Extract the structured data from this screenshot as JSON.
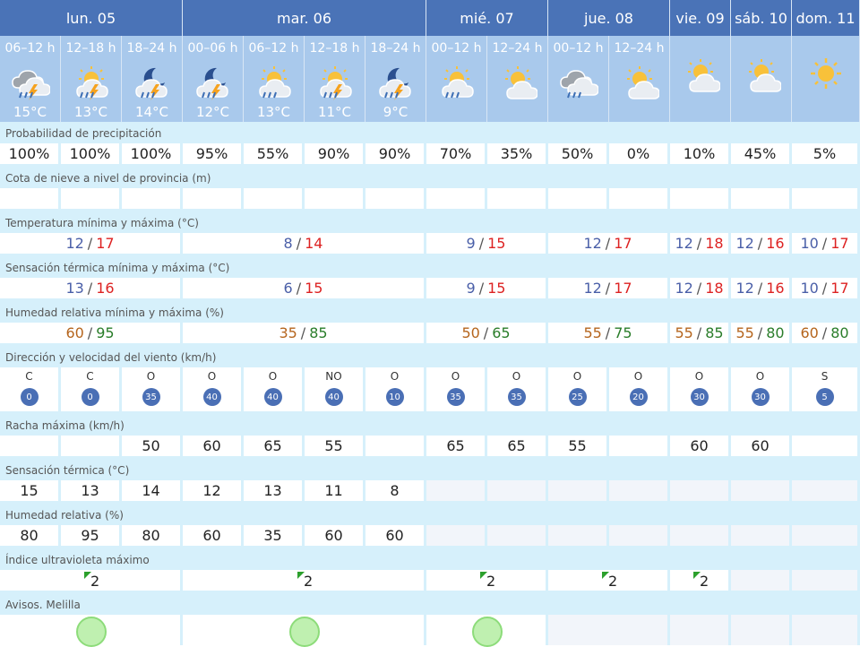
{
  "days": [
    "lun. 05",
    "mar. 06",
    "mié. 07",
    "jue. 08",
    "vie. 09",
    "sáb. 10",
    "dom. 11"
  ],
  "periods": [
    {
      "label": "06–12 h",
      "temp": "15°C",
      "icon": "storm-cloud-icon"
    },
    {
      "label": "12–18 h",
      "temp": "13°C",
      "icon": "sun-storm-rain-icon"
    },
    {
      "label": "18–24 h",
      "temp": "14°C",
      "icon": "night-storm-rain-icon"
    },
    {
      "label": "00–06 h",
      "temp": "12°C",
      "icon": "night-storm-rain-icon"
    },
    {
      "label": "06–12 h",
      "temp": "13°C",
      "icon": "sun-cloud-rain-icon"
    },
    {
      "label": "12–18 h",
      "temp": "11°C",
      "icon": "sun-storm-rain-icon"
    },
    {
      "label": "18–24 h",
      "temp": "9°C",
      "icon": "night-storm-rain-icon"
    },
    {
      "label": "00–12 h",
      "temp": "",
      "icon": "sun-cloud-rain-icon"
    },
    {
      "label": "12–24 h",
      "temp": "",
      "icon": "sun-cloud-icon"
    },
    {
      "label": "00–12 h",
      "temp": "",
      "icon": "cloud-rain-icon"
    },
    {
      "label": "12–24 h",
      "temp": "",
      "icon": "sun-cloud-icon"
    },
    {
      "label": "",
      "temp": "",
      "icon": "sun-cloud-icon"
    },
    {
      "label": "",
      "temp": "",
      "icon": "sun-cloud-icon"
    },
    {
      "label": "",
      "temp": "",
      "icon": "sun-icon"
    }
  ],
  "labels": {
    "precip": "Probabilidad de precipitación",
    "snow": "Cota de nieve a nivel de provincia (m)",
    "temp": "Temperatura mínima y máxima (°C)",
    "feels": "Sensación térmica mínima y máxima (°C)",
    "humidity": "Humedad relativa mínima y máxima (%)",
    "wind": "Dirección y velocidad del viento (km/h)",
    "gust": "Racha máxima (km/h)",
    "feels_temp": "Sensación térmica (°C)",
    "rel_hum": "Humedad relativa (%)",
    "uv": "Índice ultravioleta máximo",
    "alerts": "Avisos. Melilla"
  },
  "precip": [
    "100%",
    "100%",
    "100%",
    "95%",
    "55%",
    "90%",
    "90%",
    "70%",
    "35%",
    "50%",
    "0%",
    "10%",
    "45%",
    "5%"
  ],
  "temp_minmax": [
    {
      "min": "12",
      "max": "17"
    },
    {
      "min": "8",
      "max": "14"
    },
    {
      "min": "9",
      "max": "15"
    },
    {
      "min": "12",
      "max": "17"
    },
    {
      "min": "12",
      "max": "18"
    },
    {
      "min": "12",
      "max": "16"
    },
    {
      "min": "10",
      "max": "17"
    }
  ],
  "feels_minmax": [
    {
      "min": "13",
      "max": "16"
    },
    {
      "min": "6",
      "max": "15"
    },
    {
      "min": "9",
      "max": "15"
    },
    {
      "min": "12",
      "max": "17"
    },
    {
      "min": "12",
      "max": "18"
    },
    {
      "min": "12",
      "max": "16"
    },
    {
      "min": "10",
      "max": "17"
    }
  ],
  "hum_minmax": [
    {
      "min": "60",
      "max": "95"
    },
    {
      "min": "35",
      "max": "85"
    },
    {
      "min": "50",
      "max": "65"
    },
    {
      "min": "55",
      "max": "75"
    },
    {
      "min": "55",
      "max": "85"
    },
    {
      "min": "55",
      "max": "80"
    },
    {
      "min": "60",
      "max": "80"
    }
  ],
  "wind": [
    {
      "dir": "C",
      "speed": "0"
    },
    {
      "dir": "C",
      "speed": "0"
    },
    {
      "dir": "O",
      "speed": "35"
    },
    {
      "dir": "O",
      "speed": "40"
    },
    {
      "dir": "O",
      "speed": "40"
    },
    {
      "dir": "NO",
      "speed": "40"
    },
    {
      "dir": "O",
      "speed": "10"
    },
    {
      "dir": "O",
      "speed": "35"
    },
    {
      "dir": "O",
      "speed": "35"
    },
    {
      "dir": "O",
      "speed": "25"
    },
    {
      "dir": "O",
      "speed": "20"
    },
    {
      "dir": "O",
      "speed": "30"
    },
    {
      "dir": "O",
      "speed": "30"
    },
    {
      "dir": "S",
      "speed": "5"
    }
  ],
  "gust": [
    "",
    "",
    "50",
    "60",
    "65",
    "55",
    "",
    "65",
    "65",
    "55",
    "",
    "60",
    "60",
    ""
  ],
  "feels_temp": [
    "15",
    "13",
    "14",
    "12",
    "13",
    "11",
    "8"
  ],
  "rel_hum": [
    "80",
    "95",
    "80",
    "60",
    "35",
    "60",
    "60"
  ],
  "uv": [
    "2",
    "2",
    "2",
    "2",
    "2"
  ],
  "alerts_count": 3,
  "colors": {
    "day_header": "#4a73b7",
    "period_header": "#a9c9ec",
    "label_row": "#d6f0fb",
    "temp_min": "#4a5fa8",
    "temp_max": "#dd2222",
    "hum_min": "#b5651d",
    "hum_max": "#2a7d2a",
    "wind_circle": "#4a6fb5",
    "alert_green": "#bff0b0"
  }
}
